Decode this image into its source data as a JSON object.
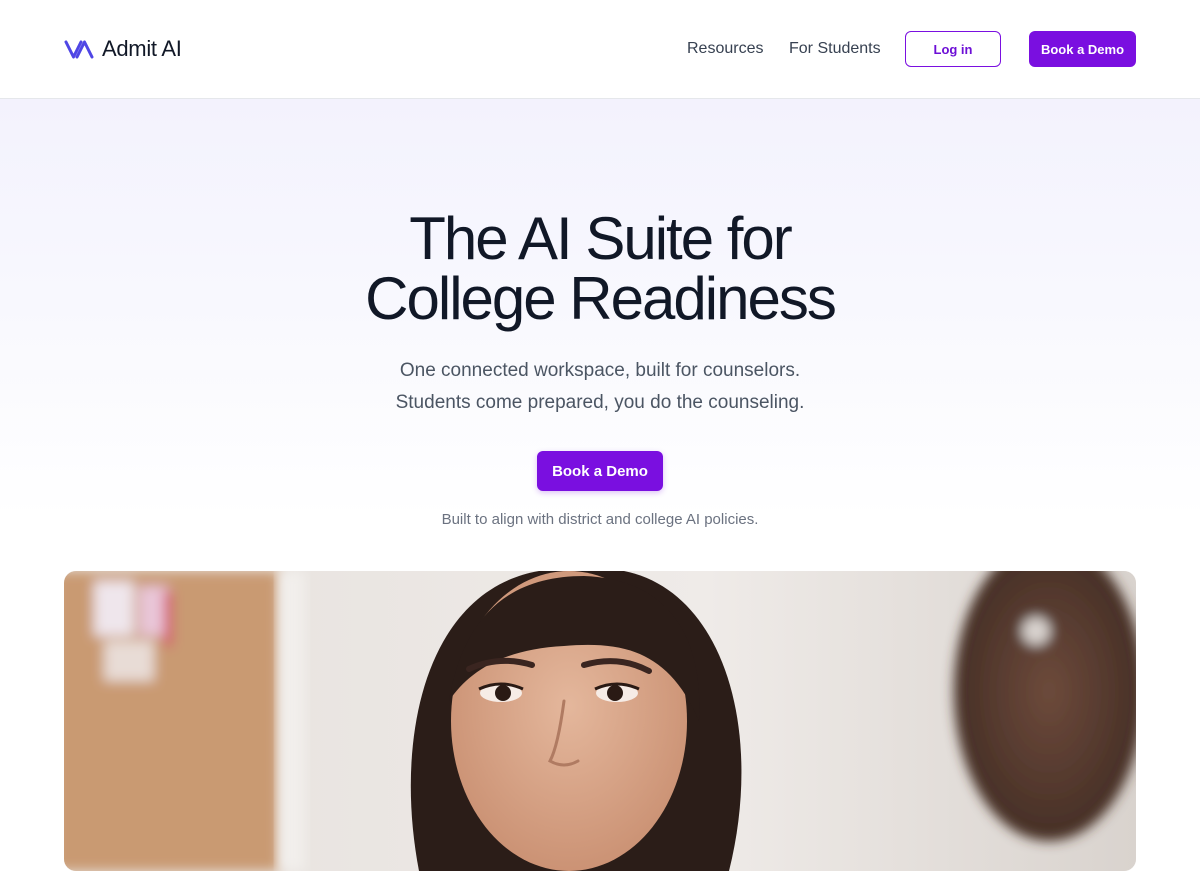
{
  "brand": {
    "name": "Admit AI",
    "logo_icon": "admit-ai-logo-icon"
  },
  "nav": {
    "links": [
      {
        "label": "Resources"
      },
      {
        "label": "For Students"
      }
    ],
    "login_label": "Log in",
    "demo_label": "Book a Demo"
  },
  "hero": {
    "title_line1": "The AI Suite for",
    "title_line2": "College Readiness",
    "subtitle_line1": "One connected workspace, built for counselors.",
    "subtitle_line2": "Students come prepared, you do the counseling.",
    "cta_label": "Book a Demo",
    "note": "Built to align with district and college AI policies."
  },
  "colors": {
    "accent": "#7a0fe0",
    "logo": "#4f46e5",
    "text_primary": "#111827",
    "text_secondary": "#4b5563",
    "hero_bg_top": "#f3f2fd"
  }
}
